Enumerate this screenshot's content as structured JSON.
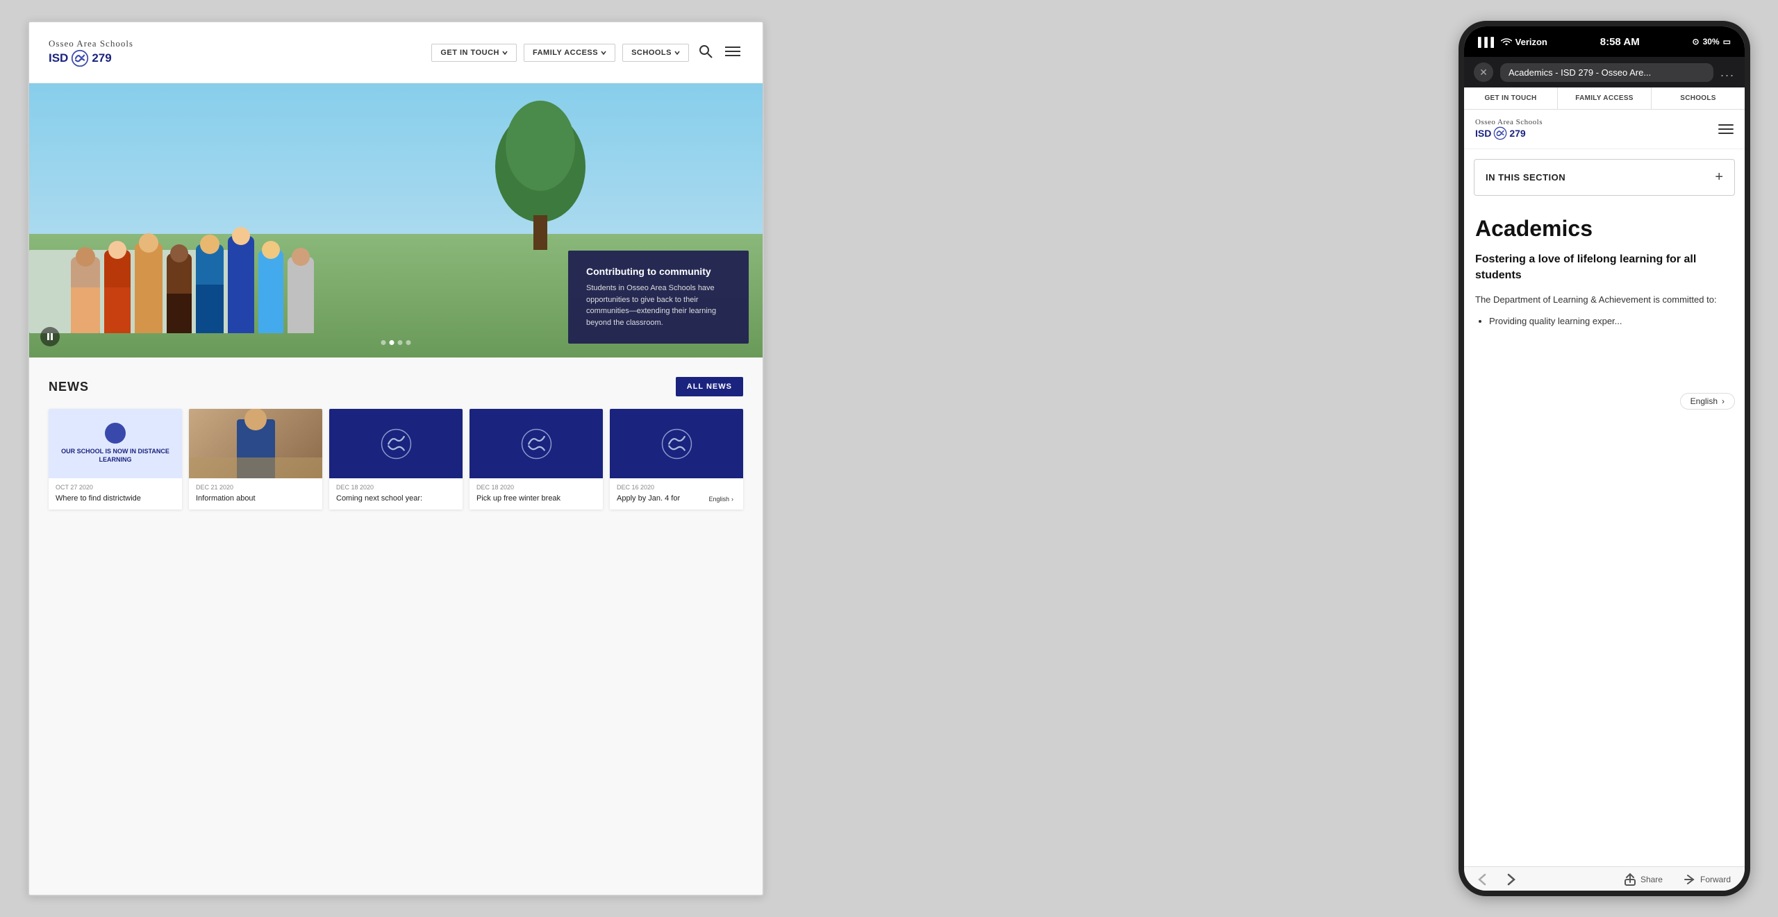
{
  "left": {
    "header": {
      "school_name": "Osseo Area Schools",
      "isd_label": "ISD",
      "isd_number": "279",
      "nav_buttons": [
        {
          "label": "GET IN TOUCH",
          "id": "get-in-touch"
        },
        {
          "label": "FAMILY ACCESS",
          "id": "family-access"
        },
        {
          "label": "SCHOOLS",
          "id": "schools"
        }
      ]
    },
    "hero": {
      "overlay_title": "Contributing to community",
      "overlay_text": "Students in Osseo Area Schools have opportunities to give back to their communities—extending their learning beyond the classroom."
    },
    "news": {
      "section_title": "NEWS",
      "all_news_label": "ALL NEWS",
      "cards": [
        {
          "date": "OCT 27 2020",
          "headline": "Where to find districtwide",
          "thumb_type": "illustration",
          "thumb_text": "OUR SCHOOL IS NOW IN DISTANCE LEARNING"
        },
        {
          "date": "DEC 21 2020",
          "headline": "Information about",
          "thumb_type": "photo"
        },
        {
          "date": "DEC 18 2020",
          "headline": "Coming next school year:",
          "thumb_type": "logo-dark"
        },
        {
          "date": "DEC 18 2020",
          "headline": "Pick up free winter break",
          "thumb_type": "logo-dark"
        },
        {
          "date": "DEC 16 2020",
          "headline": "Apply by Jan. 4 for",
          "thumb_type": "logo-dark"
        }
      ],
      "english_label": "English",
      "english_arrow": "›"
    }
  },
  "right": {
    "status_bar": {
      "carrier": "Verizon",
      "time": "8:58 AM",
      "battery": "30%"
    },
    "browser": {
      "url": "Academics - ISD 279 - Osseo Are...",
      "close_label": "✕",
      "more_label": "..."
    },
    "nav_tabs": [
      {
        "label": "GET IN TOUCH"
      },
      {
        "label": "FAMILY ACCESS"
      },
      {
        "label": "SCHOOLS"
      }
    ],
    "mobile_header": {
      "school_name": "Osseo Area Schools",
      "isd_label": "ISD",
      "isd_number": "279"
    },
    "in_this_section": {
      "label": "IN THIS SECTION",
      "plus": "+"
    },
    "academics": {
      "title": "Academics",
      "subtitle": "Fostering a love of lifelong learning for all students",
      "body": "The Department of Learning & Achievement is committed to:",
      "list_items": [
        "Providing quality learning exper..."
      ]
    },
    "english_btn": {
      "label": "English",
      "arrow": "›"
    },
    "bottom_bar": {
      "share_label": "Share",
      "forward_label": "Forward"
    }
  }
}
